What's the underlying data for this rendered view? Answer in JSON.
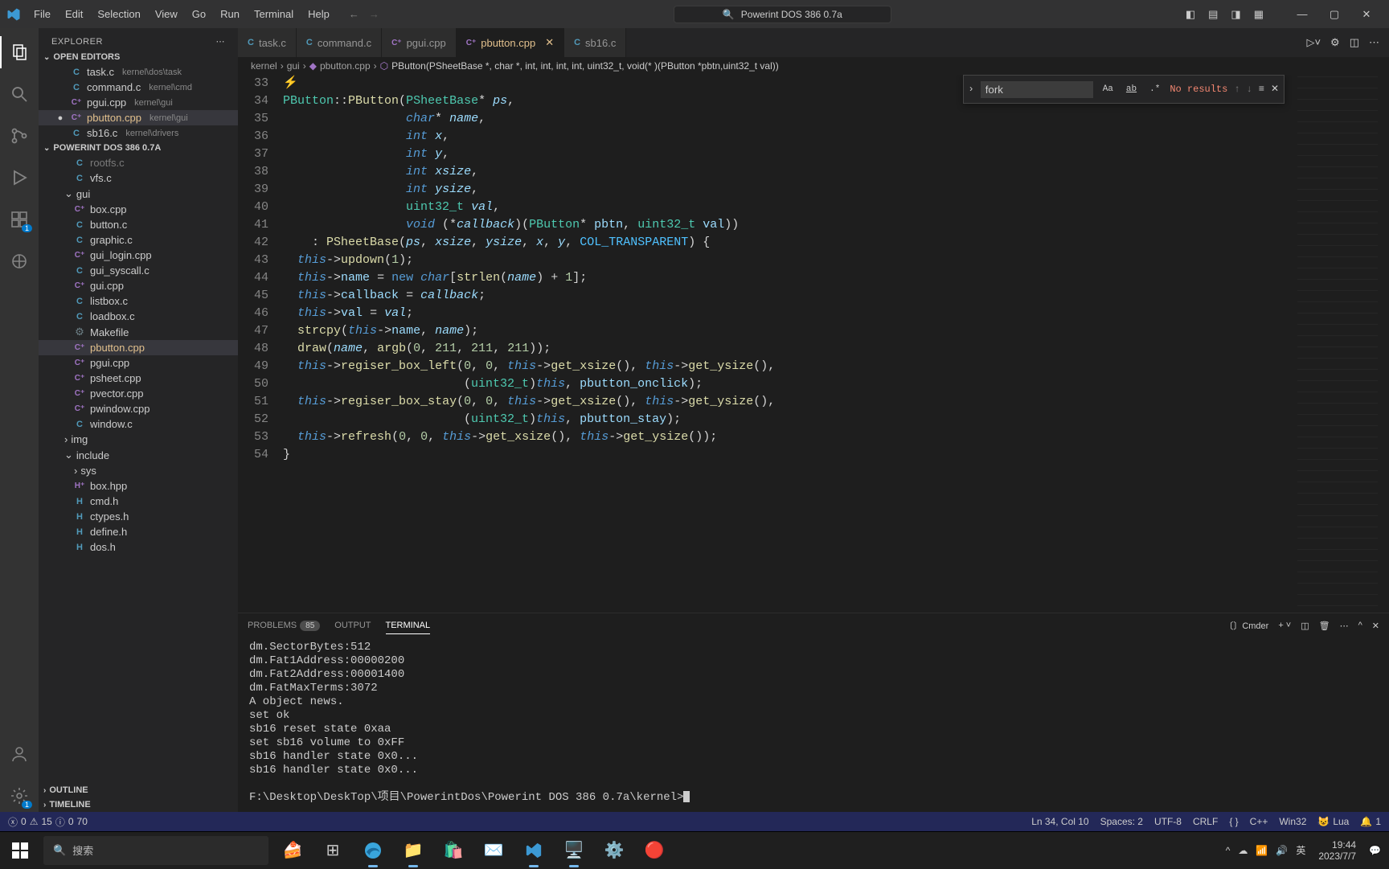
{
  "titlebar": {
    "menus": [
      "File",
      "Edit",
      "Selection",
      "View",
      "Go",
      "Run",
      "Terminal",
      "Help"
    ],
    "title": "Powerint DOS 386 0.7a"
  },
  "sidebar": {
    "header": "EXPLORER",
    "open_editors_label": "OPEN EDITORS",
    "open_editors": [
      {
        "icon": "c",
        "name": "task.c",
        "path": "kernel\\dos\\task"
      },
      {
        "icon": "c",
        "name": "command.c",
        "path": "kernel\\cmd"
      },
      {
        "icon": "cpp",
        "name": "pgui.cpp",
        "path": "kernel\\gui"
      },
      {
        "icon": "cpp",
        "name": "pbutton.cpp",
        "path": "kernel\\gui",
        "active": true,
        "dirty": true
      },
      {
        "icon": "c",
        "name": "sb16.c",
        "path": "kernel\\drivers"
      }
    ],
    "project_label": "POWERINT DOS 386 0.7A",
    "tree": [
      {
        "icon": "c",
        "name": "rootfs.c",
        "ind": 2,
        "cut": true
      },
      {
        "icon": "c",
        "name": "vfs.c",
        "ind": 2
      },
      {
        "type": "folder",
        "open": true,
        "name": "gui",
        "ind": 1
      },
      {
        "icon": "cpp",
        "name": "box.cpp",
        "ind": 2
      },
      {
        "icon": "c",
        "name": "button.c",
        "ind": 2
      },
      {
        "icon": "c",
        "name": "graphic.c",
        "ind": 2
      },
      {
        "icon": "cpp",
        "name": "gui_login.cpp",
        "ind": 2
      },
      {
        "icon": "c",
        "name": "gui_syscall.c",
        "ind": 2
      },
      {
        "icon": "cpp",
        "name": "gui.cpp",
        "ind": 2
      },
      {
        "icon": "c",
        "name": "listbox.c",
        "ind": 2
      },
      {
        "icon": "c",
        "name": "loadbox.c",
        "ind": 2
      },
      {
        "icon": "mk",
        "name": "Makefile",
        "ind": 2
      },
      {
        "icon": "cpp",
        "name": "pbutton.cpp",
        "ind": 2,
        "active": true
      },
      {
        "icon": "cpp",
        "name": "pgui.cpp",
        "ind": 2
      },
      {
        "icon": "cpp",
        "name": "psheet.cpp",
        "ind": 2
      },
      {
        "icon": "cpp",
        "name": "pvector.cpp",
        "ind": 2
      },
      {
        "icon": "cpp",
        "name": "pwindow.cpp",
        "ind": 2
      },
      {
        "icon": "c",
        "name": "window.c",
        "ind": 2
      },
      {
        "type": "folder",
        "open": false,
        "name": "img",
        "ind": 1
      },
      {
        "type": "folder",
        "open": true,
        "name": "include",
        "ind": 1
      },
      {
        "type": "folder",
        "open": false,
        "name": "sys",
        "ind": 2
      },
      {
        "icon": "hpp",
        "name": "box.hpp",
        "ind": 2
      },
      {
        "icon": "h",
        "name": "cmd.h",
        "ind": 2
      },
      {
        "icon": "h",
        "name": "ctypes.h",
        "ind": 2
      },
      {
        "icon": "h",
        "name": "define.h",
        "ind": 2
      },
      {
        "icon": "h",
        "name": "dos.h",
        "ind": 2
      }
    ],
    "outline_label": "OUTLINE",
    "timeline_label": "TIMELINE"
  },
  "tabs": [
    {
      "icon": "c",
      "name": "task.c"
    },
    {
      "icon": "c",
      "name": "command.c"
    },
    {
      "icon": "cpp",
      "name": "pgui.cpp"
    },
    {
      "icon": "cpp",
      "name": "pbutton.cpp",
      "active": true,
      "close": true
    },
    {
      "icon": "c",
      "name": "sb16.c"
    }
  ],
  "breadcrumb": [
    "kernel",
    "gui",
    "pbutton.cpp",
    "PButton(PSheetBase *, char *, int, int, int, int, uint32_t, void(* )(PButton *pbtn,uint32_t val))"
  ],
  "find": {
    "value": "fork",
    "result": "No results",
    "opts": [
      "Aa",
      "ab",
      ".*"
    ]
  },
  "code_lines": [
    33,
    34,
    35,
    36,
    37,
    38,
    39,
    40,
    41,
    42,
    43,
    44,
    45,
    46,
    47,
    48,
    49,
    50,
    51,
    52,
    53,
    54
  ],
  "panel": {
    "tabs": {
      "problems": "PROBLEMS",
      "problems_badge": "85",
      "output": "OUTPUT",
      "terminal": "TERMINAL"
    },
    "shell_name": "Cmder",
    "terminal_lines": [
      "dm.SectorBytes:512",
      "dm.Fat1Address:00000200",
      "dm.Fat2Address:00001400",
      "dm.FatMaxTerms:3072",
      "A object news.",
      "set ok",
      "sb16 reset state 0xaa",
      "set sb16 volume to 0xFF",
      "sb16 handler state 0x0...",
      "sb16 handler state 0x0..."
    ],
    "prompt": "F:\\Desktop\\DeskTop\\项目\\PowerintDos\\Powerint DOS 386 0.7a\\kernel>"
  },
  "status": {
    "errors": "0",
    "warnings": "15",
    "info": "0",
    "hints": "70",
    "pos": "Ln 34, Col 10",
    "spaces": "Spaces: 2",
    "enc": "UTF-8",
    "eol": "CRLF",
    "lang": "C++",
    "port": "Win32",
    "lua": "Lua",
    "bell": "1"
  },
  "taskbar": {
    "search_placeholder": "搜索",
    "ime": "英",
    "time": "19:44",
    "date": "2023/7/7"
  }
}
